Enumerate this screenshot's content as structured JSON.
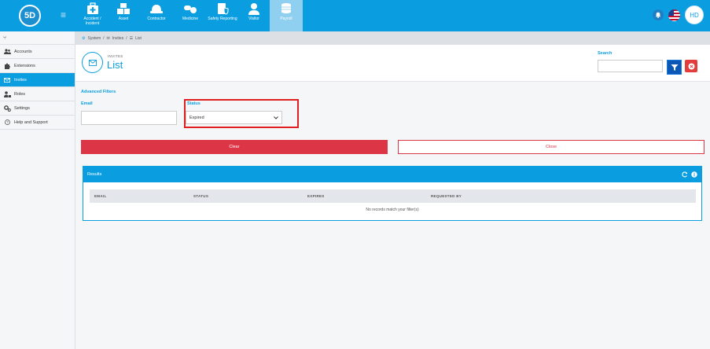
{
  "app": {
    "logo_text": "5D",
    "user_initials": "HD"
  },
  "modules": [
    {
      "label": "Accident / Incident",
      "icon": "medkit-icon"
    },
    {
      "label": "Asset",
      "icon": "boxes-icon"
    },
    {
      "label": "Contractor",
      "icon": "hardhat-icon"
    },
    {
      "label": "Medicine",
      "icon": "pills-icon"
    },
    {
      "label": "Safety Reporting",
      "icon": "safety-report-icon"
    },
    {
      "label": "Visitor",
      "icon": "user-icon"
    },
    {
      "label": "Payroll",
      "icon": "coins-icon"
    }
  ],
  "breadcrumb": {
    "system": "System",
    "sep1": "/",
    "invites": "Invites",
    "sep2": "/",
    "list": "List"
  },
  "sidebar": {
    "items": [
      {
        "label": "Accounts",
        "icon": "users-icon"
      },
      {
        "label": "Extensions",
        "icon": "puzzle-icon"
      },
      {
        "label": "Invites",
        "icon": "envelope-icon"
      },
      {
        "label": "Roles",
        "icon": "user-lock-icon"
      },
      {
        "label": "Settings",
        "icon": "cogs-icon"
      },
      {
        "label": "Help and Support",
        "icon": "question-icon"
      }
    ],
    "active": "Invites"
  },
  "header": {
    "subtitle": "INVITES",
    "title": "List",
    "search_label": "Search",
    "search_value": ""
  },
  "filters": {
    "title": "Advanced Filters",
    "email_label": "Email",
    "email_value": "",
    "status_label": "Status",
    "status_value": "Expired",
    "clear_label": "Clear",
    "close_label": "Close"
  },
  "results": {
    "title": "Results",
    "columns": [
      "EMAIL",
      "STATUS",
      "EXPIRES",
      "REQUESTED BY"
    ],
    "empty_message": "No records match your filter(s)"
  },
  "colors": {
    "primary": "#0a9ee0",
    "danger": "#dc3545",
    "highlight": "#e02020",
    "filter_button": "#0c57b5"
  }
}
